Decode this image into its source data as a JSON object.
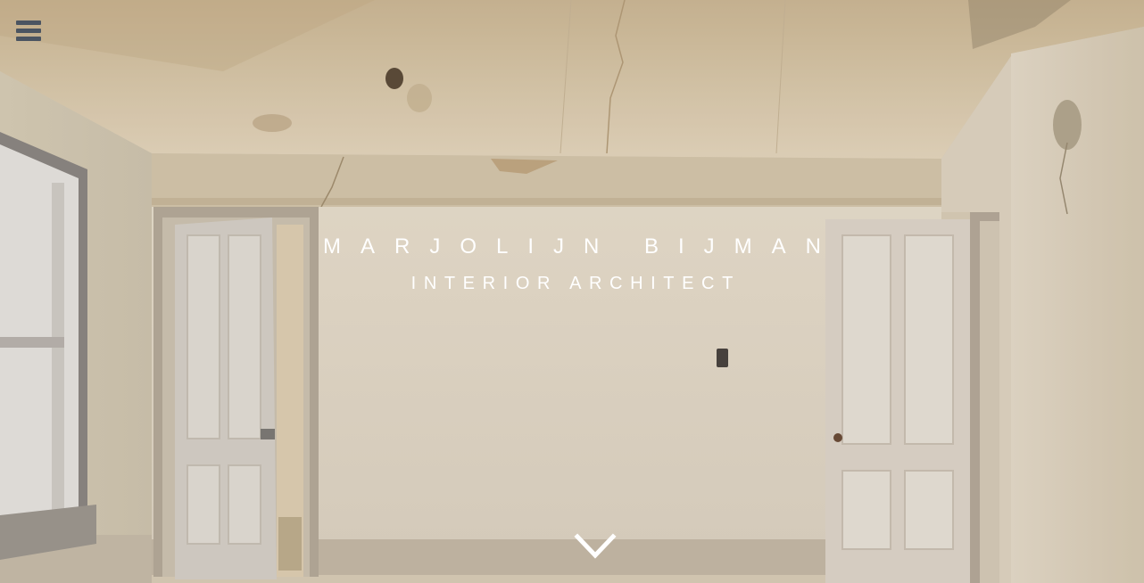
{
  "header": {
    "menu_icon": "hamburger-menu-icon"
  },
  "hero": {
    "title": "MARJOLIJN BIJMAN",
    "subtitle": "INTERIOR ARCHITECT",
    "scroll_icon": "chevron-down-icon",
    "background": "photo of a bare empty room with peeling plaster and open doors"
  },
  "colors": {
    "menu_icon": "#4b5461",
    "text": "#ffffff"
  }
}
